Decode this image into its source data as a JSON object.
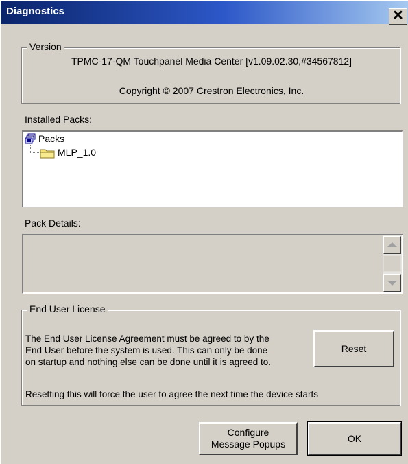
{
  "window": {
    "title": "Diagnostics",
    "close_glyph": "✕",
    "title_gradient": [
      "#0a246a",
      "#a6caf0"
    ]
  },
  "version": {
    "legend": "Version",
    "product": "TPMC-17-QM Touchpanel Media Center [v1.09.02.30,#34567812]",
    "copyright": "Copyright © 2007 Crestron Electronics, Inc."
  },
  "installed_packs": {
    "label": "Installed Packs:",
    "tree": {
      "root": {
        "label": "Packs",
        "icon": "packs-icon"
      },
      "children": [
        {
          "label": "MLP_1.0",
          "icon": "folder-icon"
        }
      ]
    }
  },
  "pack_details": {
    "label": "Pack Details:",
    "value": ""
  },
  "end_user_license": {
    "legend": "End User License",
    "description": "The End User License Agreement must be agreed to by the\nEnd User before the system is used.  This can only be done\non startup and nothing else can be done until it is agreed to.",
    "note": "Resetting this will force the user to agree the next time the device starts",
    "reset_label": "Reset"
  },
  "footer": {
    "configure_label": "Configure\nMessage Popups",
    "ok_label": "OK"
  }
}
